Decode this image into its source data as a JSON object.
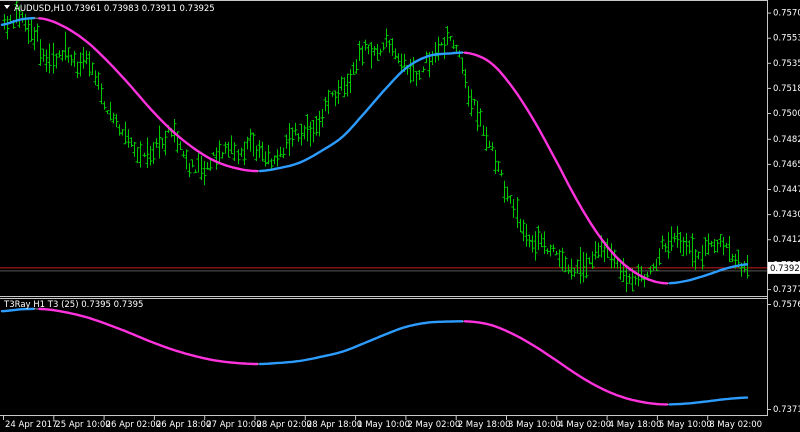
{
  "main_pane": {
    "symbol_label": "AUDUSD,H1",
    "ohlc_text": "0.73961 0.73983 0.73911 0.73925",
    "price_ticks": [
      "0.75705",
      "0.75530",
      "0.75355",
      "0.75180",
      "0.75005",
      "0.74825",
      "0.74650",
      "0.74475",
      "0.74300",
      "0.74125",
      "0.73950",
      "0.73777"
    ],
    "current_price_label": "0.73925"
  },
  "sub_pane": {
    "indicator_label": "T3Ray H1 T3 (25) 0.7395 0.7395",
    "scale_top": "0.7576",
    "scale_bottom": "0.7371"
  },
  "time_axis": [
    "24 Apr 2017",
    "25 Apr 10:00",
    "26 Apr 02:00",
    "26 Apr 18:00",
    "27 Apr 10:00",
    "28 Apr 02:00",
    "28 Apr 18:00",
    "1 May 10:00",
    "2 May 02:00",
    "2 May 18:00",
    "3 May 10:00",
    "4 May 02:00",
    "4 May 18:00",
    "5 May 10:00",
    "8 May 02:00"
  ],
  "colors": {
    "background": "#000000",
    "bars": "#00c800",
    "rising": "#2d9cff",
    "falling": "#ff33dd",
    "neutral": "#aaaaaa",
    "grid_lines": "#c8c8c8",
    "bid_line": "#c81e1e",
    "price_tag": "#ffffff"
  },
  "chart_data": [
    {
      "type": "line",
      "pane": "main",
      "title": "AUDUSD,H1",
      "ylim": [
        0.7375,
        0.7573
      ],
      "x_tick_labels": [
        "24 Apr 2017",
        "25 Apr 10:00",
        "26 Apr 02:00",
        "26 Apr 18:00",
        "27 Apr 10:00",
        "28 Apr 02:00",
        "28 Apr 18:00",
        "1 May 10:00",
        "2 May 02:00",
        "2 May 18:00",
        "3 May 10:00",
        "4 May 02:00",
        "4 May 18:00",
        "5 May 10:00",
        "8 May 02:00"
      ],
      "price_series": [
        0.756,
        0.7567,
        0.7566,
        0.7556,
        0.7536,
        0.754,
        0.7545,
        0.7535,
        0.7538,
        0.7522,
        0.7502,
        0.7495,
        0.7482,
        0.7472,
        0.7475,
        0.7478,
        0.7488,
        0.7478,
        0.7465,
        0.7458,
        0.7467,
        0.7472,
        0.7475,
        0.7472,
        0.7478,
        0.7472,
        0.7465,
        0.7475,
        0.7485,
        0.749,
        0.7484,
        0.75,
        0.7515,
        0.752,
        0.7535,
        0.7544,
        0.754,
        0.755,
        0.7545,
        0.7528,
        0.7525,
        0.754,
        0.7545,
        0.755,
        0.7547,
        0.7515,
        0.75,
        0.748,
        0.746,
        0.744,
        0.742,
        0.7412,
        0.741,
        0.7405,
        0.7398,
        0.7393,
        0.7392,
        0.74,
        0.7408,
        0.74,
        0.7392,
        0.7385,
        0.7388,
        0.7394,
        0.7408,
        0.7412,
        0.7407,
        0.7403,
        0.7407,
        0.741,
        0.7405,
        0.7397,
        0.7392
      ],
      "t3_series": [
        0.7562,
        0.7566,
        0.7566,
        0.756,
        0.755,
        0.7536,
        0.752,
        0.7503,
        0.7488,
        0.7476,
        0.7467,
        0.7462,
        0.746,
        0.7462,
        0.7466,
        0.7474,
        0.7484,
        0.75,
        0.7517,
        0.7532,
        0.754,
        0.7542,
        0.7542,
        0.7535,
        0.7518,
        0.7495,
        0.7468,
        0.744,
        0.7416,
        0.7398,
        0.7387,
        0.7382,
        0.7383,
        0.7387,
        0.7392,
        0.7395
      ],
      "current_price": 0.73925
    },
    {
      "type": "line",
      "pane": "indicator",
      "title": "T3Ray H1 T3 (25) 0.7395 0.7395",
      "ylim": [
        0.7371,
        0.7576
      ],
      "t3_series": [
        0.7562,
        0.7566,
        0.7566,
        0.756,
        0.755,
        0.7536,
        0.752,
        0.7503,
        0.7488,
        0.7476,
        0.7467,
        0.7462,
        0.746,
        0.7462,
        0.7466,
        0.7474,
        0.7484,
        0.75,
        0.7517,
        0.7532,
        0.754,
        0.7542,
        0.7542,
        0.7535,
        0.7518,
        0.7495,
        0.7468,
        0.744,
        0.7416,
        0.7398,
        0.7387,
        0.7382,
        0.7383,
        0.7387,
        0.7392,
        0.7395
      ]
    }
  ]
}
